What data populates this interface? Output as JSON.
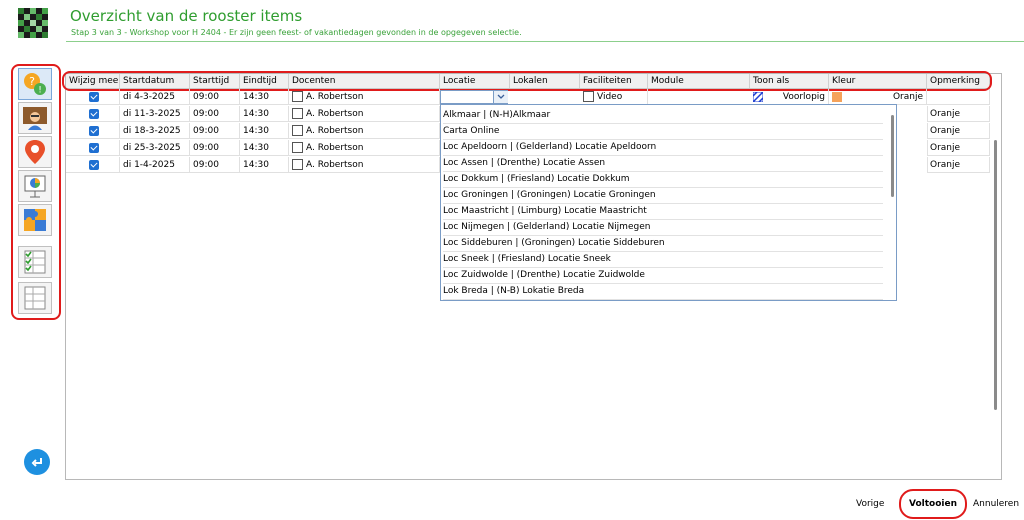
{
  "header": {
    "title": "Overzicht van de rooster items",
    "subtitle": "Stap 3 van 3 - Workshop voor H 2404 - Er zijn geen feest- of vakantiedagen gevonden in de opgegeven selectie."
  },
  "columns": [
    "Wijzig mee",
    "Startdatum",
    "Starttijd",
    "Eindtijd",
    "Docenten",
    "Locatie",
    "Lokalen",
    "Faciliteiten",
    "Module",
    "Toon als",
    "Kleur",
    "Opmerking"
  ],
  "rows": [
    {
      "date": "di 4-3-2025",
      "start": "09:00",
      "end": "14:30",
      "teacher": "A. Robertson",
      "facility": "Video",
      "show_as": "Voorlopig",
      "color": "Oranje"
    },
    {
      "date": "di 11-3-2025",
      "start": "09:00",
      "end": "14:30",
      "teacher": "A. Robertson",
      "color": "Oranje"
    },
    {
      "date": "di 18-3-2025",
      "start": "09:00",
      "end": "14:30",
      "teacher": "A. Robertson",
      "color": "Oranje"
    },
    {
      "date": "di 25-3-2025",
      "start": "09:00",
      "end": "14:30",
      "teacher": "A. Robertson",
      "color": "Oranje"
    },
    {
      "date": "di 1-4-2025",
      "start": "09:00",
      "end": "14:30",
      "teacher": "A. Robertson",
      "color": "Oranje"
    }
  ],
  "location_options": [
    "Alkmaar | (N-H)Alkmaar",
    "Carta Online",
    "Loc Apeldoorn | (Gelderland) Locatie Apeldoorn",
    "Loc Assen | (Drenthe) Locatie Assen",
    "Loc Dokkum | (Friesland) Locatie Dokkum",
    "Loc Groningen | (Groningen) Locatie Groningen",
    "Loc Maastricht | (Limburg) Locatie Maastricht",
    "Loc Nijmegen | (Gelderland) Locatie Nijmegen",
    "Loc Siddeburen | (Groningen) Locatie Siddeburen",
    "Loc Sneek | (Friesland) Locatie Sneek",
    "Loc Zuidwolde | (Drenthe) Locatie Zuidwolde",
    "Lok Breda | (N-B) Lokatie Breda"
  ],
  "footer": {
    "prev": "Vorige",
    "finish": "Voltooien",
    "cancel": "Annuleren"
  },
  "toolbar_icons": [
    "help-warning-icon",
    "teacher-icon",
    "location-pin-icon",
    "presentation-icon",
    "puzzle-icon",
    "checklist-icon",
    "grid-icon"
  ],
  "colors": {
    "accent_green": "#2f9d2f",
    "highlight_red": "#e01b1b",
    "checkbox_blue": "#1f6fd1",
    "orange_swatch": "#f5a25a"
  }
}
